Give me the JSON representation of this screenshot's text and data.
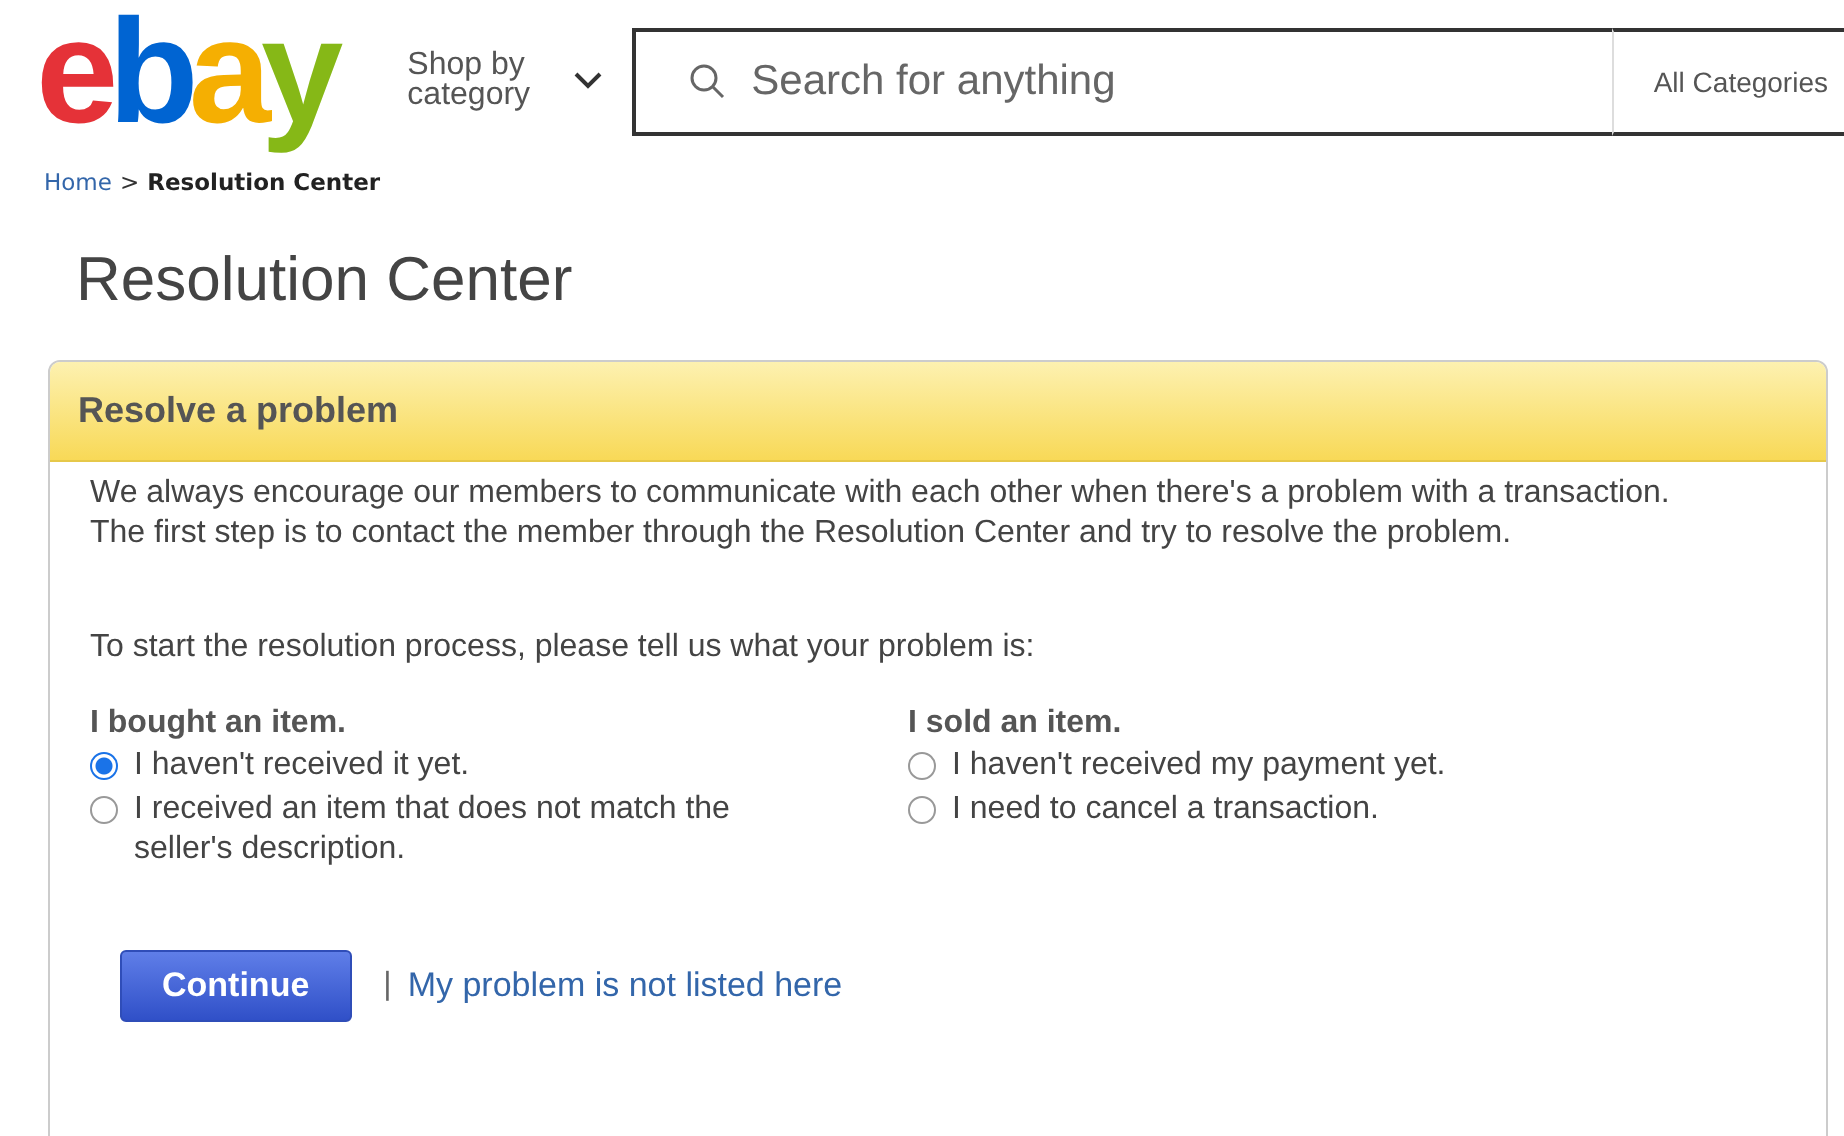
{
  "header": {
    "logo": "ebay",
    "shop_by_category": "Shop by category",
    "search": {
      "placeholder": "Search for anything"
    },
    "category_select": "All Categories"
  },
  "breadcrumb": [
    {
      "label": "Home",
      "current": false
    },
    {
      "label": "Resolution Center",
      "current": true
    }
  ],
  "breadcrumb_separator": ">",
  "page_title": "Resolution Center",
  "panel": {
    "title": "Resolve a problem",
    "intro": "We always encourage our members to communicate with each other when there's a problem with a transaction. The first step is to contact the member through the Resolution Center and try to resolve the problem.",
    "prompt": "To start the resolution process, please tell us what your problem is:",
    "groups": [
      {
        "heading": "I bought an item.",
        "options": [
          {
            "label": "I haven't received it yet.",
            "selected": true
          },
          {
            "label": "I received an item that does not match the seller's description.",
            "selected": false
          }
        ]
      },
      {
        "heading": "I sold an item.",
        "options": [
          {
            "label": "I haven't received my payment yet.",
            "selected": false
          },
          {
            "label": "I need to cancel a transaction.",
            "selected": false
          }
        ]
      }
    ],
    "continue_button": "Continue",
    "separator": "|",
    "link": "My problem is not listed here"
  }
}
